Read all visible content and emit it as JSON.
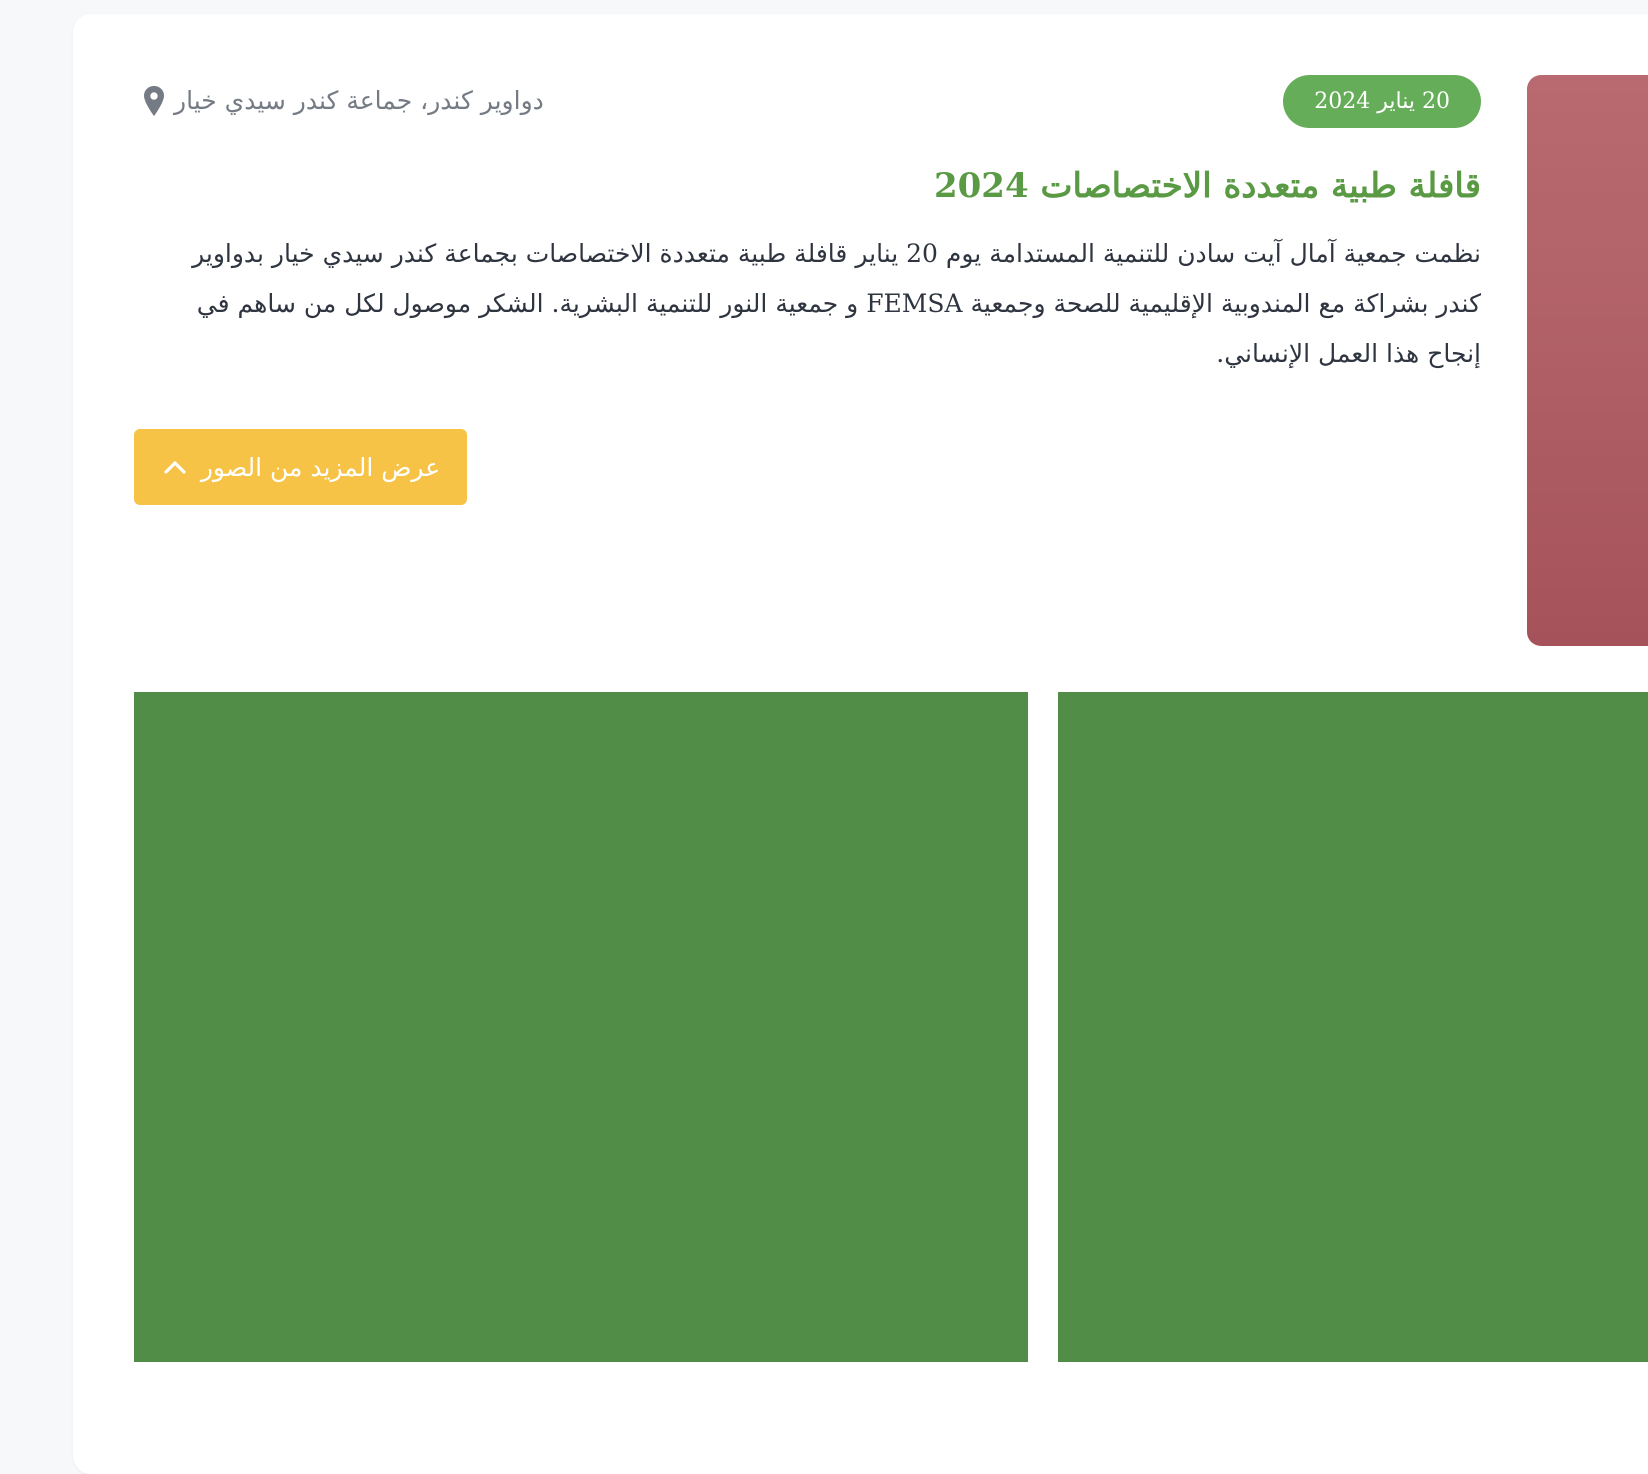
{
  "event": {
    "date": "20 يناير 2024",
    "location": "دواوير كندر، جماعة كندر سيدي خيار",
    "title": "قافلة طبية متعددة الاختصاصات 2024",
    "description": "نظمت جمعية آمال آيت سادن للتنمية المستدامة يوم 20 يناير قافلة طبية متعددة الاختصاصات بجماعة كندر سيدي خيار بدواوير كندر بشراكة مع المندوبية الإقليمية للصحة وجمعية FEMSA و جمعية النور للتنمية البشرية. الشكر موصول لكل من ساهم في إنجاح هذا العمل الإنساني.",
    "more_photos_label": "عرض المزيد من الصور"
  },
  "icons": {
    "location": "map-pin-icon",
    "more_photos": "chevron-up-icon"
  },
  "colors": {
    "badge": "#66ad59",
    "title": "#5a9a44",
    "button": "#f6c347",
    "gallery": "#518d47",
    "side_image": "#b05f66"
  }
}
